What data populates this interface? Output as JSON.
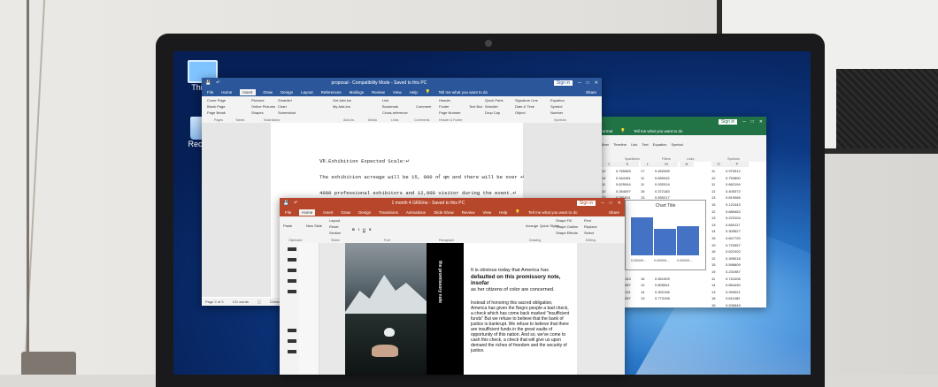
{
  "desktop": {
    "this_pc_label": "This P",
    "recycle_label": "Recycl"
  },
  "word": {
    "title": "proposal - Compatibility Mode - Saved to this PC",
    "signin": "Sign in",
    "tabs": [
      "File",
      "Home",
      "Insert",
      "Draw",
      "Design",
      "Layout",
      "References",
      "Mailings",
      "Review",
      "View",
      "Help"
    ],
    "tell_me": "Tell me what you want to do",
    "share": "Share",
    "ribbon": {
      "pages": [
        "Cover Page",
        "Blank Page",
        "Page Break"
      ],
      "pages_label": "Pages",
      "tables_label": "Tables",
      "illustrations": [
        "Pictures",
        "Online Pictures",
        "Shapes"
      ],
      "illustrations2": [
        "Chart",
        "Screenshot"
      ],
      "smartart": "SmartArt",
      "illustrations_label": "Illustrations",
      "addins": [
        "Get Add-ins",
        "My Add-ins"
      ],
      "addins_label": "Add-ins",
      "media_label": "Media",
      "links": [
        "Link",
        "Bookmark",
        "Cross-reference"
      ],
      "links_label": "Links",
      "comment": "Comment",
      "comments_label": "Comments",
      "header_footer": [
        "Header",
        "Footer",
        "Page Number"
      ],
      "header_footer_label": "Header & Footer",
      "text_box": "Text Box",
      "text": [
        "Quick Parts",
        "WordArt",
        "Drop Cap"
      ],
      "text2": [
        "Signature Line",
        "Date & Time",
        "Object"
      ],
      "symbols": [
        "Equation",
        "Symbol",
        "Number"
      ],
      "symbols_label": "Symbols"
    },
    "doc_lines": [
      "ⅥⅠ.Exhibition Expected Scale:↵",
      "The exhibition acreage will be 15, 000 ㎡ qm and there will be over ↵",
      "4000 professional exhibitors and 12,000 visitor during the event.↵"
    ],
    "status": {
      "page": "Page 2 of 3",
      "words": "121 words",
      "lang": "Chinese (PRC)"
    }
  },
  "excel": {
    "signin": "Sign in",
    "tabs": [
      "Format"
    ],
    "tell_me": "Tell me what you want to do",
    "ribbon_labels": [
      "Sparklines",
      "Filters",
      "Links",
      "Symbols"
    ],
    "ribbon_items": [
      "Slicer",
      "Timeline",
      "Link",
      "Text",
      "Equation",
      "Symbol"
    ],
    "col_headers": [
      "J",
      "K",
      "L",
      "M",
      "N",
      "O",
      "P"
    ],
    "left_cols": [
      {
        "n": [
          "12",
          "14",
          "11",
          "10",
          "13",
          "19",
          "17",
          "11",
          "13",
          "12",
          "18",
          "16",
          "11",
          "14",
          "12",
          "13",
          "15",
          "19",
          "12",
          "11"
        ],
        "v": [
          "0.765983",
          "0.344181",
          "0.625044",
          "0.264097",
          "0.291631",
          "0.574128",
          "0.880127",
          "0.215672",
          "0.932117",
          "0.511004",
          "0.706612",
          "0.433119",
          "0.624087",
          "0.395503",
          "0.871226",
          "0.038132",
          "0.657143",
          "0.392087",
          "0.746113",
          "0.601287"
        ]
      },
      {
        "n": [
          "17",
          "11",
          "11",
          "15",
          "13",
          "17",
          "14",
          "14",
          "16",
          "12",
          "14",
          "15",
          "19",
          "14",
          "15",
          "13",
          "16",
          "12",
          "14",
          "13"
        ],
        "v": [
          "0.462095",
          "0.650032",
          "0.932014",
          "0.372183",
          "0.590217",
          "0.128873",
          "0.804119",
          "0.551302",
          "0.307761",
          "0.693318",
          "0.712009",
          "0.448193",
          "0.259774",
          "0.921183",
          "0.613308",
          "0.094132",
          "0.551009",
          "0.805541",
          "0.302196",
          "0.773108"
        ]
      }
    ],
    "right_col": {
      "n": [
        "11",
        "12",
        "11",
        "12",
        "13",
        "15",
        "12",
        "13",
        "13",
        "14",
        "15",
        "19",
        "16",
        "12",
        "15",
        "19",
        "11",
        "14",
        "13",
        "18",
        "15"
      ],
      "v": [
        "0.970012",
        "0.752800",
        "0.662194",
        "0.405372",
        "0.819066",
        "0.121043",
        "0.689452",
        "0.223104",
        "0.650117",
        "0.305527",
        "0.847720",
        "0.720557",
        "0.621002",
        "0.395018",
        "0.596609",
        "0.231987",
        "0.741006",
        "0.854430",
        "0.399021",
        "0.611082",
        "0.206549"
      ]
    },
    "chart": {
      "title": "Chart Title",
      "x_labels": [
        "0.000001...",
        "0.000001...",
        "0.000001..."
      ]
    },
    "chart_data": {
      "type": "bar",
      "categories": [
        "0.000001...",
        "0.000001...",
        "0.000001..."
      ],
      "values": [
        52,
        36,
        40
      ],
      "title": "Chart Title",
      "xlabel": "",
      "ylabel": "",
      "ylim": [
        0,
        60
      ]
    }
  },
  "ppt": {
    "title": "1 month 4 GRE#ai - Saved to this PC",
    "signin": "Sign in",
    "tabs": [
      "File",
      "Home",
      "Insert",
      "Draw",
      "Design",
      "Transitions",
      "Animations",
      "Slide Show",
      "Review",
      "View",
      "Help"
    ],
    "tell_me": "Tell me what you want to do",
    "share": "Share",
    "ribbon": {
      "paste": "Paste",
      "new_slide": "New Slide",
      "layout": "Layout",
      "reset": "Reset",
      "section": "Section",
      "clipboard_label": "Clipboard",
      "slides_label": "Slides",
      "font_label": "Font",
      "paragraph_label": "Paragraph",
      "drawing_label": "Drawing",
      "editing_label": "Editing",
      "arrange": "Arrange",
      "quick_styles": "Quick Styles",
      "shape_fill": "Shape Fill",
      "shape_outline": "Shape Outline",
      "shape_effects": "Shape Effects",
      "find": "Find",
      "replace": "Replace",
      "select": "Select"
    },
    "slide": {
      "vertical_text": "the promissory note",
      "para1": "It is obvious today that America has",
      "para1_bold": "defaulted on this promissory note, insofar",
      "para1_end": "as her citizens of color are concerned.",
      "para2": [
        "Instead of honoring this sacred obligation,",
        "America has given the Negro people a bad check,",
        "a check which has come back marked \"insufficient",
        "funds\" But we refuse to believe that the bank of",
        "justice is bankrupt. We refuse to believe that there",
        "are insufficient funds in the great vaults of",
        "opportunity of this nation. And so, we've come to",
        "cash this check, a check that will give us upon",
        "demand the riches of freedom and the security of",
        "justice."
      ]
    }
  },
  "colors": {
    "word_blue": "#2b579a",
    "excel_green": "#217346",
    "ppt_orange": "#b7472a",
    "chart_bar": "#4472c4"
  }
}
